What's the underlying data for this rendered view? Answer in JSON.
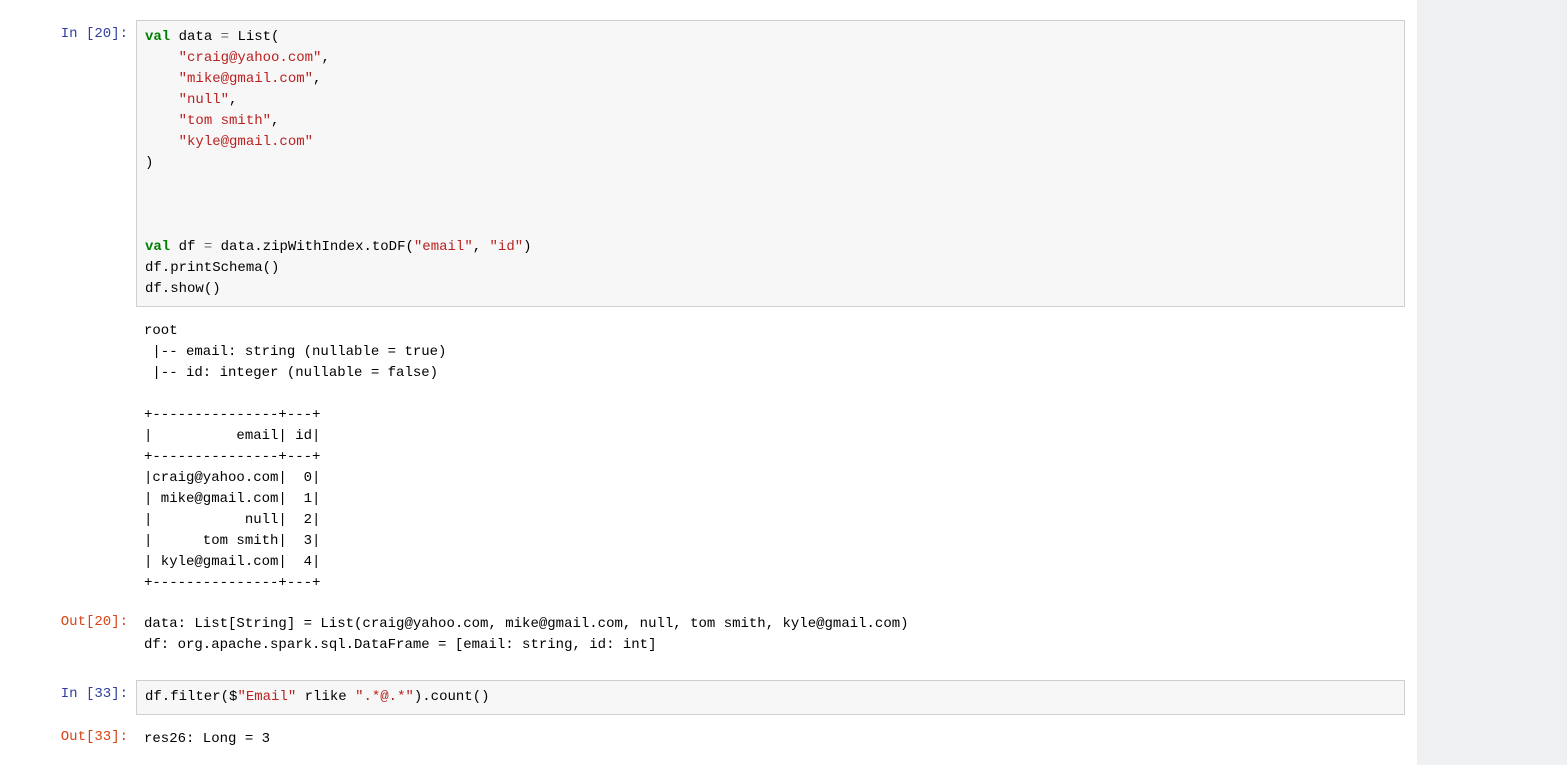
{
  "cells": {
    "c1": {
      "in_num": "20",
      "out_num": "20",
      "code": {
        "kw_val1": "val",
        "name_data": "data",
        "eq1": "=",
        "list_open": "List(",
        "s1": "\"craig@yahoo.com\"",
        "comma": ",",
        "s2": "\"mike@gmail.com\"",
        "s3": "\"null\"",
        "s4": "\"tom smith\"",
        "s5": "\"kyle@gmail.com\"",
        "close_paren": ")",
        "kw_val2": "val",
        "name_df": "df",
        "eq2": "=",
        "chain": "data.zipWithIndex.toDF",
        "todf_open": "(",
        "col1": "\"email\"",
        "col2": "\"id\"",
        "todf_close": ")",
        "print_schema": "df.printSchema",
        "paren_empty": "()",
        "show": "df.show",
        "paren_empty2": "()"
      },
      "stdout": "root\n |-- email: string (nullable = true)\n |-- id: integer (nullable = false)\n\n+---------------+---+\n|          email| id|\n+---------------+---+\n|craig@yahoo.com|  0|\n| mike@gmail.com|  1|\n|           null|  2|\n|      tom smith|  3|\n| kyle@gmail.com|  4|\n+---------------+---+\n",
      "out_text": "data: List[String] = List(craig@yahoo.com, mike@gmail.com, null, tom smith, kyle@gmail.com)\ndf: org.apache.spark.sql.DataFrame = [email: string, id: int]"
    },
    "c2": {
      "in_num": "33",
      "out_num": "33",
      "code": {
        "df_filter": "df.filter",
        "open": "(",
        "dollar": "$",
        "colstr": "\"Email\"",
        "rlike": " rlike ",
        "regex": "\".*@.*\"",
        "close": ")",
        "dot_count": ".count",
        "paren_empty": "()"
      },
      "out_text": "res26: Long = 3"
    }
  },
  "labels": {
    "in_prefix": "In  [",
    "in_suffix": "]:",
    "out_prefix": "Out[",
    "out_suffix": "]:"
  }
}
